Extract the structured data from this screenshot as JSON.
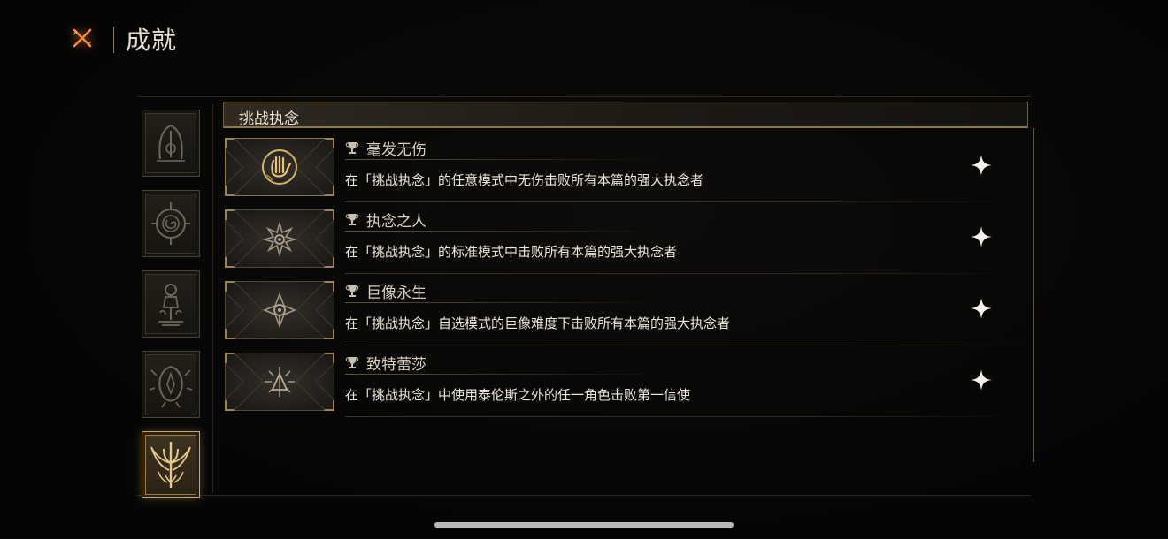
{
  "header": {
    "close_icon": "close-x-icon",
    "title": "成就"
  },
  "sidebar": {
    "tabs": [
      {
        "icon": "arch-sigil-icon",
        "active": false
      },
      {
        "icon": "spiral-compass-icon",
        "active": false
      },
      {
        "icon": "lantern-shrine-icon",
        "active": false
      },
      {
        "icon": "thorn-wreath-icon",
        "active": false
      },
      {
        "icon": "winged-trident-icon",
        "active": true
      }
    ]
  },
  "section": {
    "title": "挑战执念"
  },
  "achievements": [
    {
      "name": "毫发无伤",
      "description": "在「挑战执念」的任意模式中无伤击败所有本篇的强大执念者",
      "icon": "golden-hand-icon",
      "trophy_icon": "trophy-icon",
      "status_icon": "sparkle-star-icon",
      "unlocked": true
    },
    {
      "name": "执念之人",
      "description": "在「挑战执念」的标准模式中击败所有本篇的强大执念者",
      "icon": "spiked-eye-icon",
      "trophy_icon": "trophy-icon",
      "status_icon": "sparkle-star-icon",
      "unlocked": false
    },
    {
      "name": "巨像永生",
      "description": "在「挑战执念」自选模式的巨像难度下击败所有本篇的强大执念者",
      "icon": "radiant-eye-icon",
      "trophy_icon": "trophy-icon",
      "status_icon": "sparkle-star-icon",
      "unlocked": false
    },
    {
      "name": "致特蕾莎",
      "description": "在「挑战执念」中使用泰伦斯之外的任一角色击败第一信使",
      "icon": "burst-triangle-icon",
      "trophy_icon": "trophy-icon",
      "status_icon": "sparkle-star-icon",
      "unlocked": false
    }
  ],
  "colors": {
    "accent_gold": "#c9a463",
    "close_orange": "#e0782a",
    "text_light": "#ebe6da"
  }
}
